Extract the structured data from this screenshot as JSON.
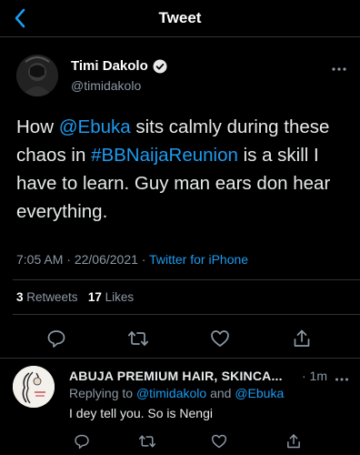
{
  "header": {
    "title": "Tweet",
    "back_icon": "chevron-left-icon"
  },
  "colors": {
    "accent": "#1d9bf0",
    "background": "#000000",
    "muted": "#8b98a5"
  },
  "tweet": {
    "author_name": "Timi Dakolo",
    "author_handle": "@timidakolo",
    "verified": true,
    "text": {
      "p1": "How ",
      "mention": "@Ebuka",
      "p2": " sits calmly during these chaos in ",
      "hashtag": "#BBNaijaReunion",
      "p3": " is a skill I have to learn. Guy man ears don hear everything."
    },
    "time": "7:05 AM",
    "sep1": " · ",
    "date": "22/06/2021",
    "sep2": " · ",
    "source": "Twitter for iPhone",
    "retweets_count": "3",
    "retweets_label": "Retweets",
    "likes_count": "17",
    "likes_label": "Likes"
  },
  "reply": {
    "author_name": "ABUJA PREMIUM HAIR, SKINCA...",
    "time": "· 1m",
    "replying_prefix": "Replying to ",
    "mention1": "@timidakolo",
    "and_text": " and ",
    "mention2": "@Ebuka",
    "text": "I dey tell you. So is Nengi"
  }
}
